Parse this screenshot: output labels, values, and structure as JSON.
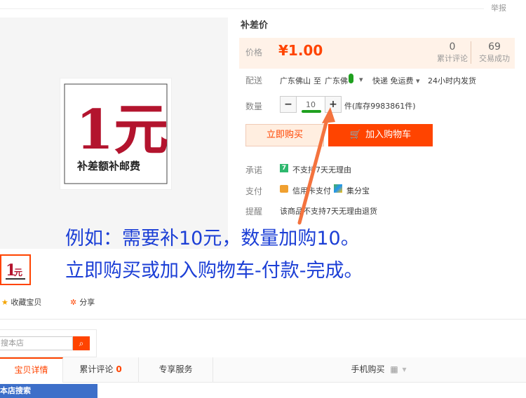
{
  "header": {
    "report": "举报"
  },
  "product": {
    "title": "补差价",
    "image_text": {
      "big": "1元",
      "caption": "补差额补邮费"
    }
  },
  "price": {
    "label": "价格",
    "value": "¥1.00"
  },
  "stats": {
    "reviews": {
      "count": "0",
      "label": "累计评论"
    },
    "sales": {
      "count": "69",
      "label": "交易成功"
    }
  },
  "delivery": {
    "label": "配送",
    "from": "广东佛山",
    "to_word": "至",
    "dest": "广东佛",
    "express": "快递 免运费",
    "ship_time": "24小时内发货"
  },
  "quantity": {
    "label": "数量",
    "value": "10",
    "minus": "−",
    "plus": "+",
    "stock": "件(库存9983861件)"
  },
  "buttons": {
    "buy_now": "立即购买",
    "add_cart": "加入购物车"
  },
  "promise": {
    "label": "承诺",
    "icon_text": "7",
    "text": "不支持7天无理由"
  },
  "payment": {
    "label": "支付",
    "method1": "信用卡支付",
    "method2": "集分宝"
  },
  "reminder": {
    "label": "提醒",
    "text": "该商品不支持7天无理由退货"
  },
  "annotation": {
    "line1": "例如：需要补10元，数量加购10。",
    "line2": "立即购买或加入购物车-付款-完成。"
  },
  "actions": {
    "favorite": "收藏宝贝",
    "share": "分享"
  },
  "shop_search": {
    "placeholder": "搜本店",
    "section": "本店搜索"
  },
  "tabs": {
    "details": "宝贝详情",
    "reviews": "累计评论",
    "reviews_count": "0",
    "service": "专享服务",
    "mobile": "手机购买"
  },
  "colors": {
    "accent": "#ff4400",
    "annotation": "#1c3fd6",
    "highlight": "#1fa01f",
    "arrow": "#f4733e"
  }
}
